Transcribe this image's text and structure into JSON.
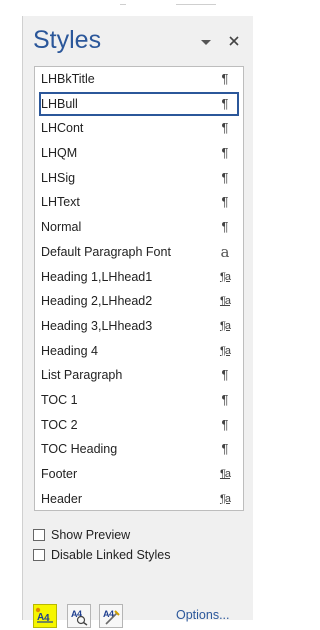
{
  "header": {
    "title": "Styles"
  },
  "styles": [
    {
      "name": "LHBkTitle",
      "mark": "¶",
      "kind": "para"
    },
    {
      "name": "LHBull",
      "mark": "¶",
      "kind": "para",
      "selected": true
    },
    {
      "name": "LHCont",
      "mark": "¶",
      "kind": "para"
    },
    {
      "name": "LHQM",
      "mark": "¶",
      "kind": "para"
    },
    {
      "name": "LHSig",
      "mark": "¶",
      "kind": "para"
    },
    {
      "name": "LHText",
      "mark": "¶",
      "kind": "para"
    },
    {
      "name": "Normal",
      "mark": "¶",
      "kind": "para"
    },
    {
      "name": "Default Paragraph Font",
      "mark": "a",
      "kind": "char"
    },
    {
      "name": "Heading 1,LHhead1",
      "mark": "¶a",
      "kind": "linked"
    },
    {
      "name": "Heading 2,LHhead2",
      "mark": "¶a",
      "kind": "linked"
    },
    {
      "name": "Heading 3,LHhead3",
      "mark": "¶a",
      "kind": "linked"
    },
    {
      "name": "Heading 4",
      "mark": "¶a",
      "kind": "linked"
    },
    {
      "name": "List Paragraph",
      "mark": "¶",
      "kind": "para"
    },
    {
      "name": "TOC 1",
      "mark": "¶",
      "kind": "para"
    },
    {
      "name": "TOC 2",
      "mark": "¶",
      "kind": "para"
    },
    {
      "name": "TOC Heading",
      "mark": "¶",
      "kind": "para"
    },
    {
      "name": "Footer",
      "mark": "¶a",
      "kind": "linked"
    },
    {
      "name": "Header",
      "mark": "¶a",
      "kind": "linked"
    }
  ],
  "options": {
    "show_preview": "Show Preview",
    "disable_linked": "Disable Linked Styles",
    "options_link": "Options..."
  },
  "icons": {
    "new_style": "new-style-icon",
    "style_inspector": "style-inspector-icon",
    "manage_styles": "manage-styles-icon"
  },
  "colors": {
    "accent": "#2b579a",
    "highlight": "#f6f600",
    "pane_bg": "#f0f0f0"
  }
}
